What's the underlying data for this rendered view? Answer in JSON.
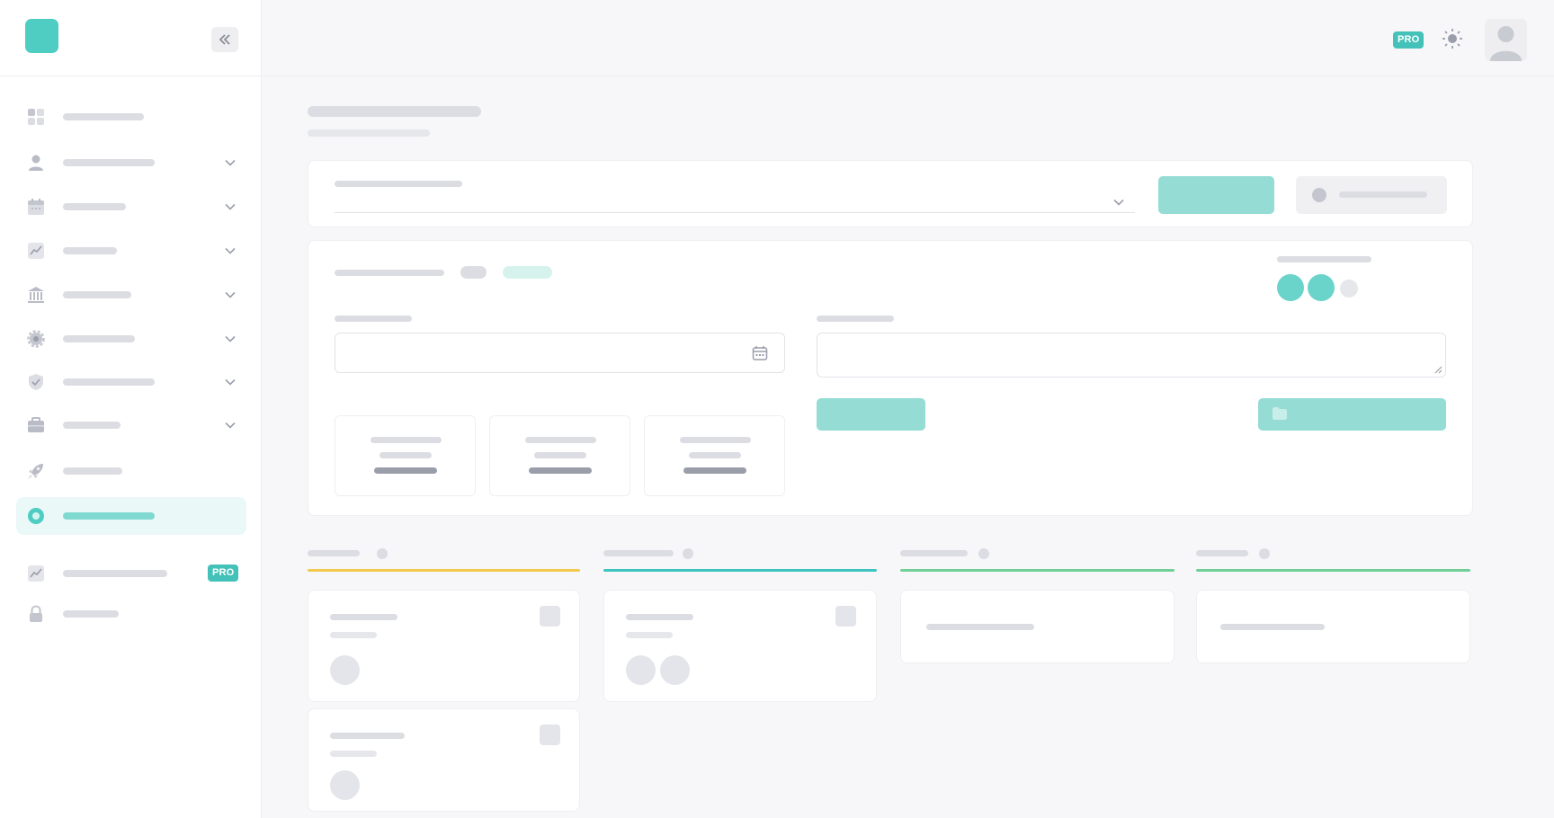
{
  "brand": {
    "accent": "#4fcdc3",
    "accent_soft": "#95dcd5",
    "pro_color": "#44c2b9"
  },
  "header": {
    "pro_badge": "PRO",
    "theme_icon": "sun-icon",
    "avatar_icon": "user-avatar-icon"
  },
  "sidebar": {
    "collapse_icon": "double-chevron-left-icon",
    "items": [
      {
        "icon": "dashboard-grid-icon",
        "expandable": false
      },
      {
        "icon": "user-icon",
        "expandable": true
      },
      {
        "icon": "calendar-icon",
        "expandable": true
      },
      {
        "icon": "chart-line-icon",
        "expandable": true
      },
      {
        "icon": "bank-icon",
        "expandable": true
      },
      {
        "icon": "gear-icon",
        "expandable": true
      },
      {
        "icon": "shield-check-icon",
        "expandable": true
      },
      {
        "icon": "briefcase-icon",
        "expandable": true
      },
      {
        "icon": "rocket-icon",
        "expandable": false
      },
      {
        "icon": "circle-icon",
        "expandable": false,
        "active": true
      },
      {
        "icon": "chart-line-icon",
        "expandable": false,
        "badge": "PRO"
      },
      {
        "icon": "lock-icon",
        "expandable": false
      }
    ]
  },
  "board": {
    "columns": [
      {
        "color": "#f2c94c"
      },
      {
        "color": "#3cc5bf"
      },
      {
        "color": "#6fcf97"
      },
      {
        "color": "#6fcf97"
      }
    ]
  }
}
